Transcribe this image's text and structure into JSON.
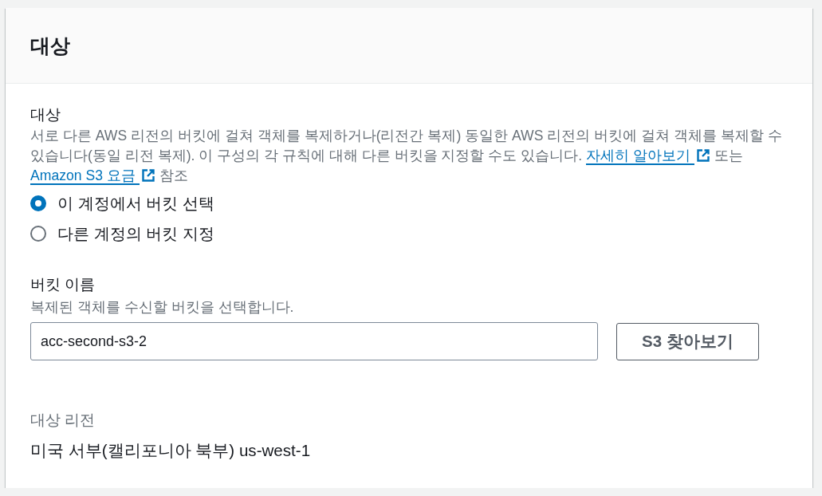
{
  "panel": {
    "title": "대상"
  },
  "destination": {
    "label": "대상",
    "description": [
      {
        "kind": "text",
        "text": "서로 다른 AWS 리전의 버킷에 걸쳐 객체를 복제하거나(리전간 복제) 동일한 AWS 리전의 버킷에 걸쳐 객체를 복제할 수 있습니다(동일 리전 복제). 이 구성의 각 규칙에 대해 다른 버킷을 지정할 수도 있습니다. "
      },
      {
        "kind": "link",
        "text": "자세히 알아보기"
      },
      {
        "kind": "text",
        "text": " 또는 "
      },
      {
        "kind": "link",
        "text": "Amazon S3 요금"
      },
      {
        "kind": "text",
        "text": " 참조"
      }
    ],
    "options": [
      {
        "label": "이 계정에서 버킷 선택",
        "selected": true
      },
      {
        "label": "다른 계정의 버킷 지정",
        "selected": false
      }
    ]
  },
  "bucket": {
    "label": "버킷 이름",
    "hint": "복제된 객체를 수신할 버킷을 선택합니다.",
    "value": "acc-second-s3-2",
    "browse_button": "S3 찾아보기"
  },
  "region": {
    "label": "대상 리전",
    "value": "미국 서부(캘리포니아 북부) us-west-1"
  }
}
